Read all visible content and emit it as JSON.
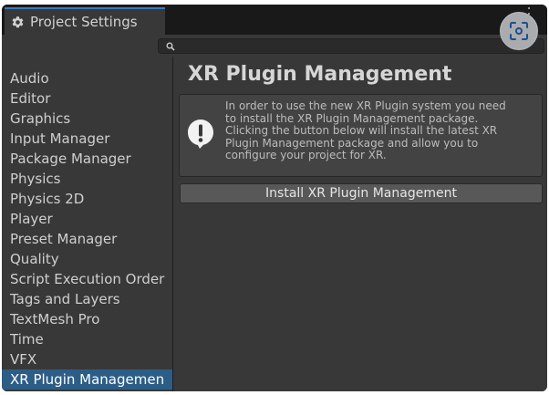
{
  "window": {
    "tab_title": "Project Settings",
    "tab_icon": "gear-icon",
    "menu_icon": "vertical-ellipsis-icon",
    "accent_color": "#3a79bb"
  },
  "toolbar": {
    "search": {
      "placeholder": "",
      "value": "",
      "icon": "search-icon"
    }
  },
  "overlay": {
    "capture_icon": "screen-capture-icon"
  },
  "sidebar": {
    "selected_color": "#2c5d87",
    "items": [
      {
        "label": "Audio",
        "selected": false
      },
      {
        "label": "Editor",
        "selected": false
      },
      {
        "label": "Graphics",
        "selected": false
      },
      {
        "label": "Input Manager",
        "selected": false
      },
      {
        "label": "Package Manager",
        "selected": false
      },
      {
        "label": "Physics",
        "selected": false
      },
      {
        "label": "Physics 2D",
        "selected": false
      },
      {
        "label": "Player",
        "selected": false
      },
      {
        "label": "Preset Manager",
        "selected": false
      },
      {
        "label": "Quality",
        "selected": false
      },
      {
        "label": "Script Execution Order",
        "selected": false
      },
      {
        "label": "Tags and Layers",
        "selected": false
      },
      {
        "label": "TextMesh Pro",
        "selected": false
      },
      {
        "label": "Time",
        "selected": false
      },
      {
        "label": "VFX",
        "selected": false
      },
      {
        "label": "XR Plugin Managemen",
        "selected": true
      }
    ]
  },
  "main": {
    "title": "XR Plugin Management",
    "help": {
      "icon": "warning-icon",
      "lines": [
        "In order to use the new XR Plugin system you need",
        "to install the XR Plugin Management package.",
        "Clicking the button below will install the latest XR",
        "Plugin Management package and allow you to",
        "configure your project for XR."
      ]
    },
    "install_button_label": "Install XR Plugin Management"
  }
}
